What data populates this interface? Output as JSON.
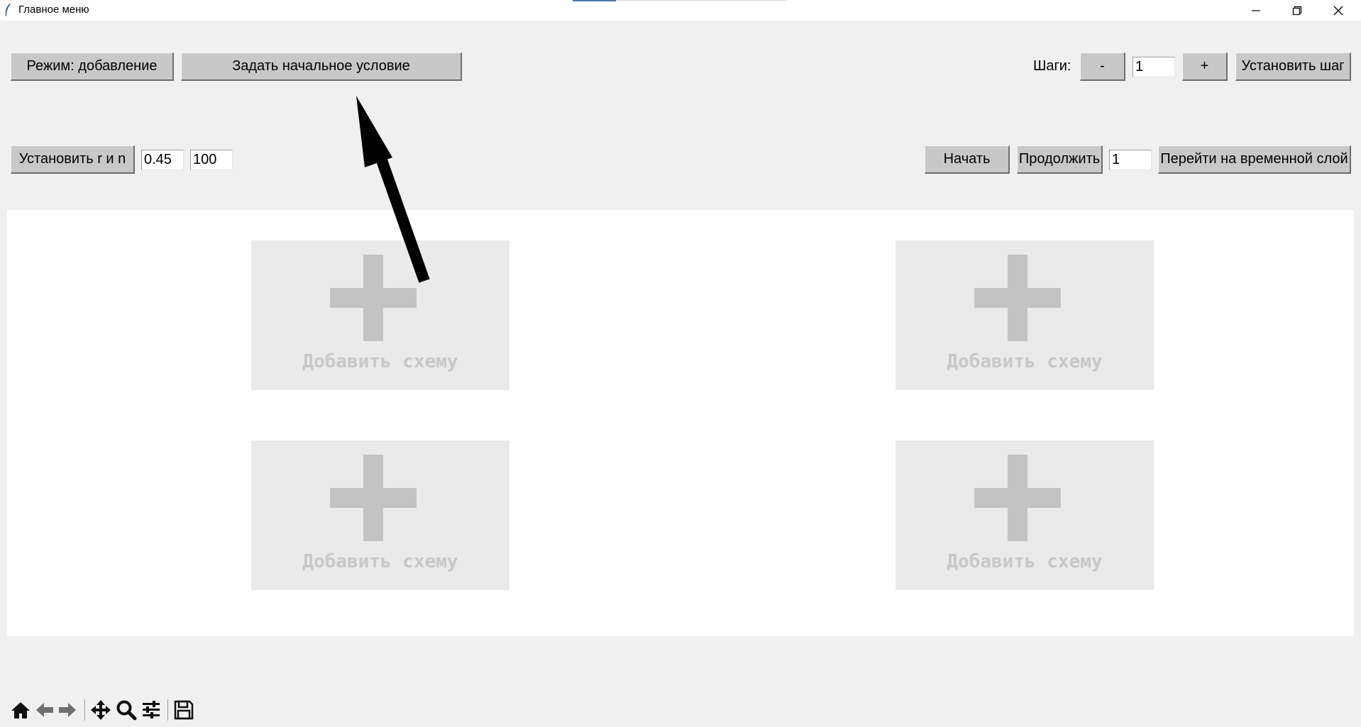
{
  "window": {
    "title": "Главное меню",
    "minimize_icon": "minimize-icon",
    "restore_icon": "restore-icon",
    "close_icon": "close-icon"
  },
  "row1": {
    "mode_button": "Режим: добавление",
    "initial_condition_button": "Задать начальное условие",
    "steps_label": "Шаги:",
    "minus_button": "-",
    "steps_value": "1",
    "plus_button": "+",
    "set_step_button": "Установить шаг"
  },
  "row2": {
    "set_r_n_button": "Установить r и n",
    "r_value": "0.45",
    "n_value": "100",
    "start_button": "Начать",
    "continue_button": "Продолжить",
    "layer_value": "1",
    "goto_layer_button": "Перейти на временной слой"
  },
  "schemes": [
    {
      "label": "Добавить схему",
      "icon": "plus-icon"
    },
    {
      "label": "Добавить схему",
      "icon": "plus-icon"
    },
    {
      "label": "Добавить схему",
      "icon": "plus-icon"
    },
    {
      "label": "Добавить схему",
      "icon": "plus-icon"
    }
  ],
  "annotation": {
    "icon": "arrow-annotation",
    "color": "#000000"
  },
  "toolbar": {
    "items": [
      "home-icon",
      "back-icon",
      "forward-icon",
      "pan-icon",
      "zoom-icon",
      "configure-subplots-icon",
      "save-icon"
    ]
  },
  "colors": {
    "background": "#f0f0f0",
    "button": "#c8c8c8",
    "canvas": "#ffffff",
    "scheme_tile": "#eaeaea",
    "scheme_text": "#c8c8c8"
  }
}
